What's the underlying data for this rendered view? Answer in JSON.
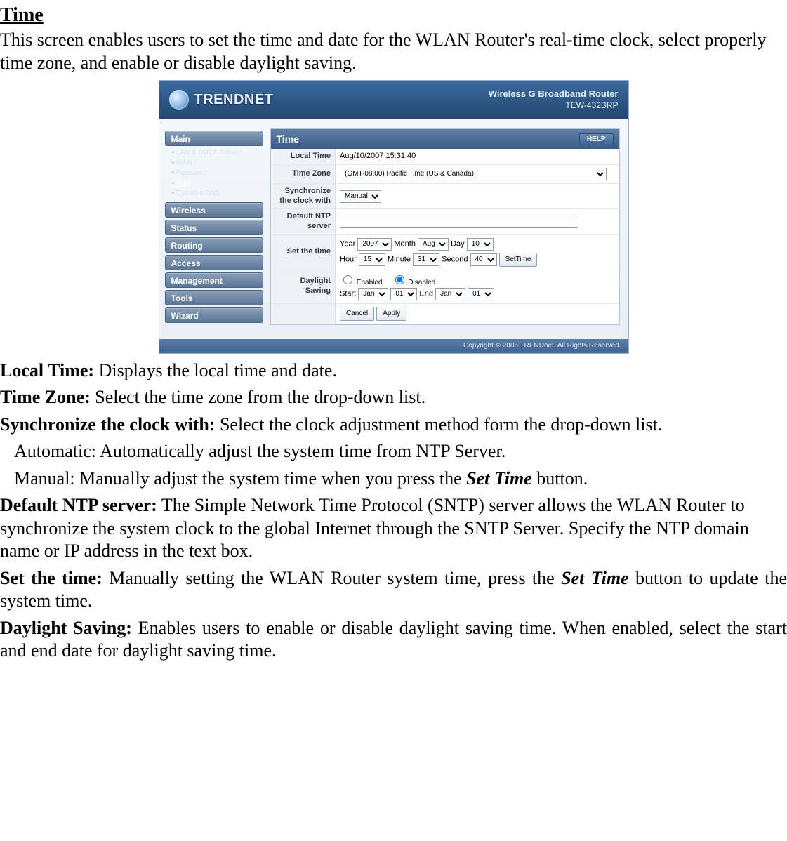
{
  "doc": {
    "title": "Time",
    "intro": "This screen enables users to set the time and date for the WLAN Router's real-time clock, select properly time zone, and enable or disable daylight saving.",
    "local_time_h": "Local Time:",
    "local_time_t": " Displays the local time and date.",
    "tz_h": "Time Zone:",
    "tz_t": " Select the time zone from the drop-down list.",
    "sync_h": "Synchronize the clock with:",
    "sync_t": " Select the clock adjustment method form the drop-down list.",
    "auto_line": "Automatic: Automatically adjust the system time from NTP Server.",
    "manual_pre": "Manual: Manually adjust the system time when you press the ",
    "manual_em": "Set Time",
    "manual_post": " button.",
    "ntp_h": "Default NTP server:",
    "ntp_t": " The Simple Network Time Protocol (SNTP) server allows the WLAN Router to synchronize the system clock to the global Internet through the SNTP Server. Specify the NTP domain name or IP address in the text box.",
    "settime_h": "Set the time:",
    "settime_pre": " Manually setting the WLAN Router system time, press the ",
    "settime_em": "Set Time",
    "settime_post": " button to update the system time.",
    "ds_h": "Daylight Saving:",
    "ds_t": " Enables users to enable or disable daylight saving time. When enabled, select the start and end date for daylight saving time."
  },
  "router": {
    "brand": "TRENDNET",
    "product_line": "Wireless G Broadband Router",
    "model": "TEW-432BRP",
    "nav": {
      "main": "Main",
      "subitems": {
        "lan": "LAN & DHCP Server",
        "wan": "WAN",
        "password": "Password",
        "time": "Time",
        "ddns": "Dynamic DNS"
      },
      "wireless": "Wireless",
      "status": "Status",
      "routing": "Routing",
      "access": "Access",
      "management": "Management",
      "tools": "Tools",
      "wizard": "Wizard"
    },
    "page": {
      "title": "Time",
      "help": "HELP",
      "labels": {
        "local_time": "Local Time",
        "time_zone": "Time Zone",
        "sync": "Synchronize the clock with",
        "ntp": "Default NTP server",
        "set_time": "Set the time",
        "daylight": "Daylight Saving"
      },
      "local_time_value": "Aug/10/2007 15:31:40",
      "tz_value": "(GMT-08:00) Pacific Time (US & Canada)",
      "sync_value": "Manual",
      "ntp_value": "",
      "set": {
        "year_l": "Year",
        "year_v": "2007",
        "month_l": "Month",
        "month_v": "Aug",
        "day_l": "Day",
        "day_v": "10",
        "hour_l": "Hour",
        "hour_v": "15",
        "minute_l": "Minute",
        "minute_v": "31",
        "second_l": "Second",
        "second_v": "40",
        "btn": "SetTime"
      },
      "daylight": {
        "enabled": "Enabled",
        "disabled": "Disabled",
        "checked": "disabled",
        "start_l": "Start",
        "start_m": "Jan",
        "start_d": "01",
        "end_l": "End",
        "end_m": "Jan",
        "end_d": "01"
      },
      "buttons": {
        "cancel": "Cancel",
        "apply": "Apply"
      }
    },
    "footer": "Copyright © 2006 TRENDnet. All Rights Reserved."
  }
}
